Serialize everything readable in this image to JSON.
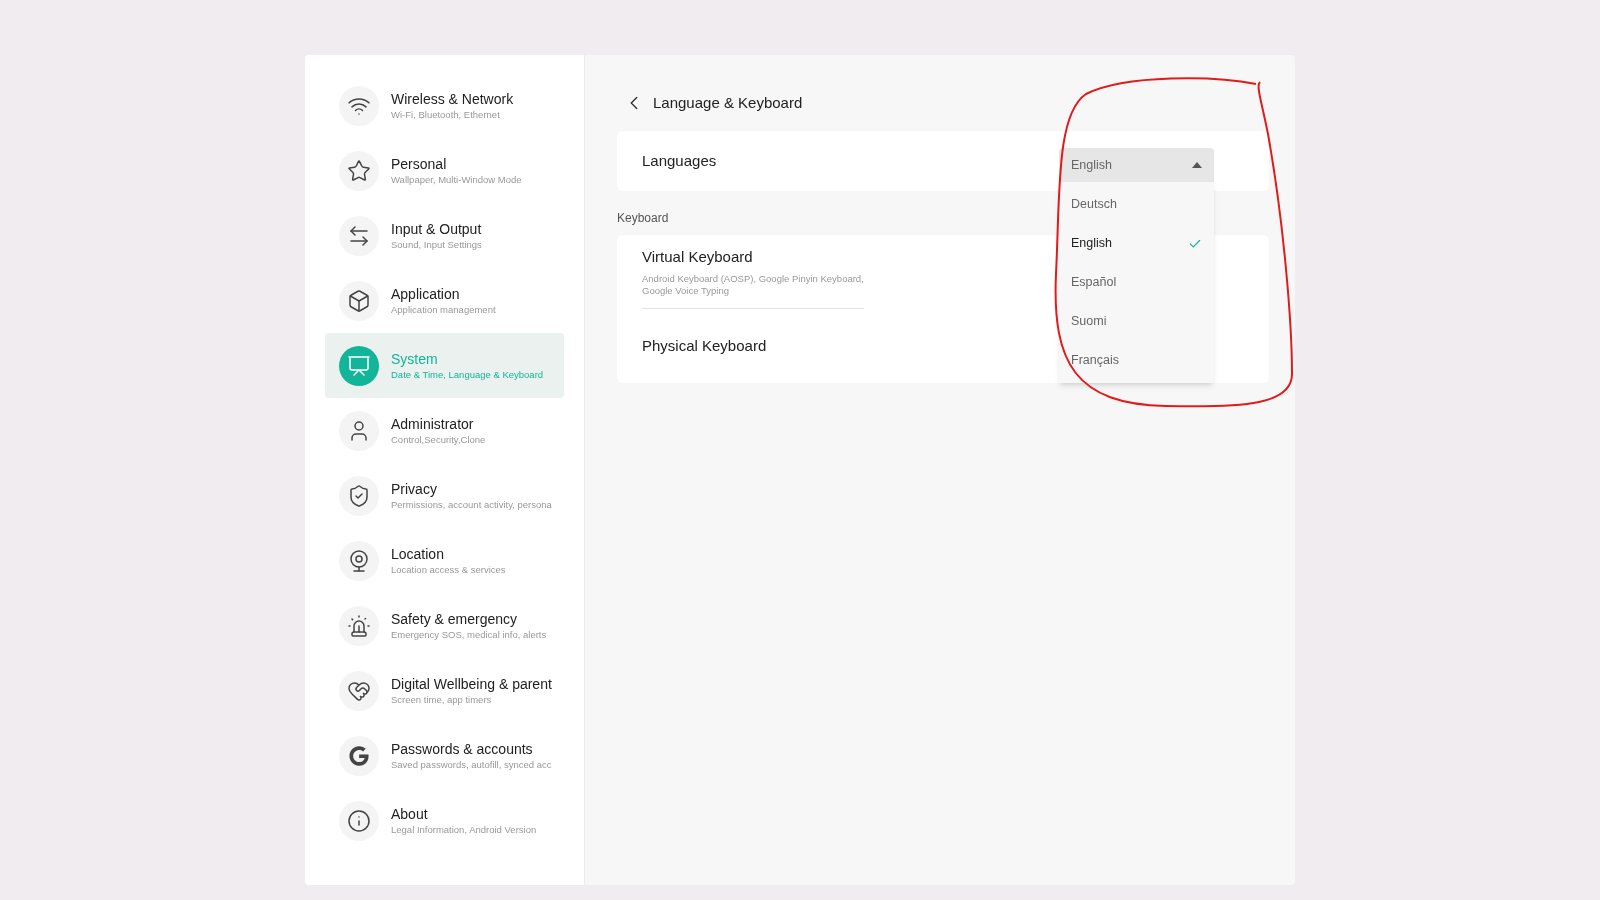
{
  "sidebar": {
    "items": [
      {
        "title": "Wireless & Network",
        "subtitle": "Wi-Fi, Bluetooth, Ethernet",
        "selected": false
      },
      {
        "title": "Personal",
        "subtitle": "Wallpaper, Multi-Window Mode",
        "selected": false
      },
      {
        "title": "Input & Output",
        "subtitle": "Sound, Input Settings",
        "selected": false
      },
      {
        "title": "Application",
        "subtitle": "Application management",
        "selected": false
      },
      {
        "title": "System",
        "subtitle": "Date & Time, Language & Keyboard",
        "selected": true
      },
      {
        "title": "Administrator",
        "subtitle": "Control,Security,Clone",
        "selected": false
      },
      {
        "title": "Privacy",
        "subtitle": "Permissions, account activity, persona",
        "selected": false
      },
      {
        "title": "Location",
        "subtitle": "Location access & services",
        "selected": false
      },
      {
        "title": "Safety & emergency",
        "subtitle": "Emergency SOS, medical info, alerts",
        "selected": false
      },
      {
        "title": "Digital Wellbeing & parent",
        "subtitle": "Screen time, app timers",
        "selected": false
      },
      {
        "title": "Passwords & accounts",
        "subtitle": "Saved passwords, autofill, synced acc",
        "selected": false
      },
      {
        "title": "About",
        "subtitle": "Legal Information, Android Version",
        "selected": false
      }
    ]
  },
  "header": {
    "title": "Language & Keyboard"
  },
  "languages": {
    "label": "Languages",
    "value": "English",
    "expanded": true,
    "options": [
      {
        "label": "Deutsch",
        "selected": false
      },
      {
        "label": "English",
        "selected": true
      },
      {
        "label": "Español",
        "selected": false
      },
      {
        "label": "Suomi",
        "selected": false
      },
      {
        "label": "Français",
        "selected": false
      }
    ]
  },
  "keyboard": {
    "heading": "Keyboard",
    "rows": [
      {
        "title": "Virtual Keyboard",
        "subtitle": "Android Keyboard (AOSP), Google Pinyin Keyboard,\nGoogle Voice Typing"
      },
      {
        "title": "Physical Keyboard"
      }
    ]
  }
}
